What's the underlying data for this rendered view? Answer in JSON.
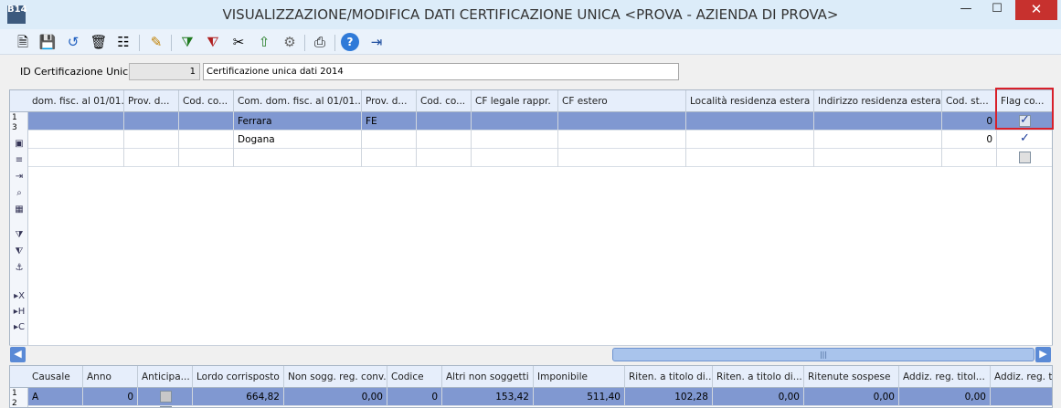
{
  "window": {
    "app_icon": "B14",
    "title": "VISUALIZZAZIONE/MODIFICA DATI CERTIFICAZIONE UNICA <PROVA - AZIENDA DI PROVA>",
    "minimize": "—",
    "maximize": "☐",
    "close": "✕"
  },
  "toolbar": {
    "buttons": [
      {
        "name": "new-document-icon",
        "glyph": "🗎"
      },
      {
        "name": "save-icon",
        "glyph": "💾"
      },
      {
        "name": "undo-icon",
        "glyph": "↺"
      },
      {
        "name": "trash-icon",
        "glyph": "🗑"
      },
      {
        "name": "binoculars-icon",
        "glyph": "☷"
      },
      {
        "name": "edit-icon",
        "glyph": "✎"
      },
      {
        "name": "filter-add-icon",
        "glyph": "⧩"
      },
      {
        "name": "filter-remove-icon",
        "glyph": "⧨"
      },
      {
        "name": "scissors-icon",
        "glyph": "✂"
      },
      {
        "name": "export-icon",
        "glyph": "⇧"
      },
      {
        "name": "gear-icon",
        "glyph": "⚙"
      },
      {
        "name": "print-icon",
        "glyph": "⎙"
      },
      {
        "name": "help-icon",
        "glyph": "?"
      },
      {
        "name": "exit-icon",
        "glyph": "⇥"
      }
    ]
  },
  "id_row": {
    "label": "ID Certificazione Unica",
    "id_value": "1",
    "description": "Certificazione unica dati 2014"
  },
  "colors": {
    "selected_row": "#8098d1",
    "header_bg": "#e6eefb",
    "highlight_border": "#d8202a"
  },
  "grid": {
    "columns": [
      "dom. fisc. al 01/01...",
      "Prov. d...",
      "Cod. co...",
      "Com. dom. fisc. al 01/01...",
      "Prov. d...",
      "Cod. co...",
      "CF legale rappr.",
      "CF estero",
      "Località residenza estera",
      "Indirizzo residenza estera",
      "Cod. st...",
      "Flag co..."
    ],
    "row_markers": [
      "1",
      "3"
    ],
    "rows": [
      {
        "c3": "Ferrara",
        "c4": "FE",
        "c10": "0",
        "flag": "checked",
        "selected": true
      },
      {
        "c3": "Dogana",
        "c4": "",
        "c10": "0",
        "flag": "checked",
        "selected": false
      },
      {
        "c3": "",
        "c4": "",
        "c10": "",
        "flag": "unchecked",
        "selected": false
      }
    ],
    "side_icons": [
      "record-icon",
      "list-icon",
      "insert-icon",
      "zoom-icon",
      "table-icon",
      "filter-icon",
      "filter-clear-icon",
      "anchor-icon",
      "sort-x-icon",
      "sort-h-icon",
      "sort-c-icon"
    ],
    "side_glyphs": {
      "record-icon": "▣",
      "list-icon": "≡",
      "insert-icon": "⇥",
      "zoom-icon": "⌕",
      "table-icon": "▦",
      "filter-icon": "⧩",
      "filter-clear-icon": "⧨",
      "anchor-icon": "⚓",
      "sort-x-icon": "▸X",
      "sort-h-icon": "▸H",
      "sort-c-icon": "▸C"
    }
  },
  "scroll": {
    "left": "◀",
    "right": "▶",
    "thumb": "|||"
  },
  "grid2": {
    "columns": [
      "Causale",
      "Anno",
      "Anticipa...",
      "Lordo corrisposto",
      "Non sogg. reg. conv.",
      "Codice",
      "Altri non soggetti",
      "Imponibile",
      "Riten. a titolo di...",
      "Riten. a titolo di...",
      "Ritenute sospese",
      "Addiz. reg. titol...",
      "Addiz. reg. ti"
    ],
    "row_markers": [
      "1",
      "2"
    ],
    "row": {
      "causale": "A",
      "anno": "0",
      "lordo": "664,82",
      "non_sogg": "0,00",
      "codice": "0",
      "altri": "153,42",
      "imponibile": "511,40",
      "riten1": "102,28",
      "riten2": "0,00",
      "sospese": "0,00",
      "addiz1": "0,00"
    }
  }
}
